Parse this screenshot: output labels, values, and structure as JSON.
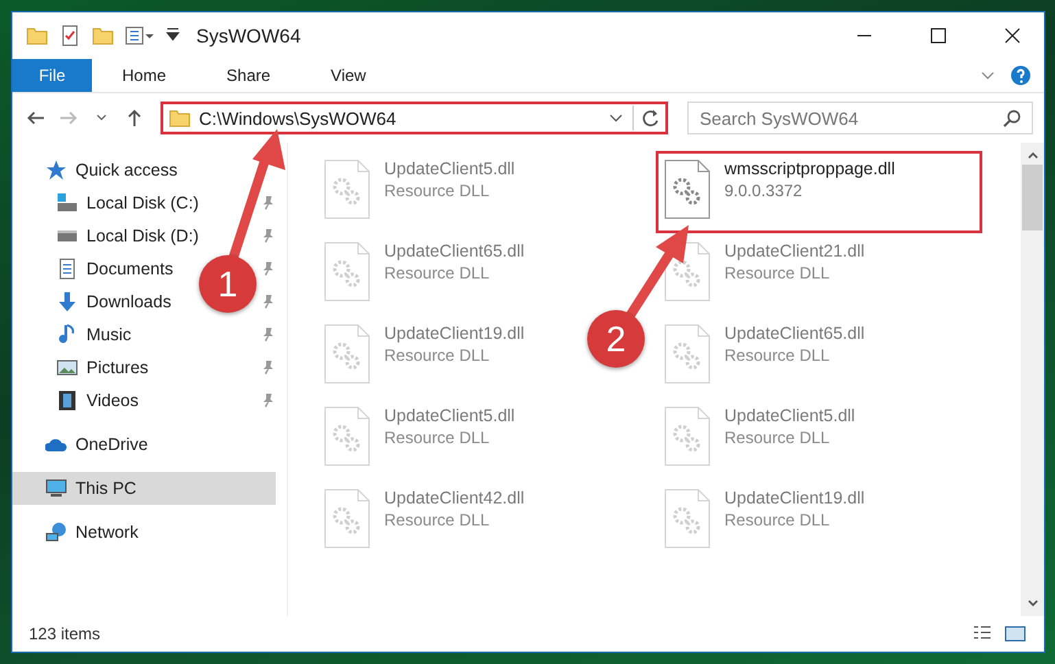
{
  "window": {
    "title": "SysWOW64"
  },
  "ribbon": {
    "file_button": "File",
    "tabs": [
      {
        "label": "Home"
      },
      {
        "label": "Share"
      },
      {
        "label": "View"
      }
    ]
  },
  "address_bar": {
    "path": "C:\\Windows\\SysWOW64",
    "highlighted": true
  },
  "search": {
    "placeholder": "Search SysWOW64"
  },
  "sidebar": {
    "items": [
      {
        "label": "Quick access",
        "kind": "star",
        "selected": false,
        "children": [
          {
            "label": "Local Disk (C:)",
            "kind": "drive-c",
            "pinned": true
          },
          {
            "label": "Local Disk (D:)",
            "kind": "drive",
            "pinned": true
          },
          {
            "label": "Documents",
            "kind": "documents",
            "pinned": true
          },
          {
            "label": "Downloads",
            "kind": "downloads",
            "pinned": true
          },
          {
            "label": "Music",
            "kind": "music",
            "pinned": true
          },
          {
            "label": "Pictures",
            "kind": "pictures",
            "pinned": true
          },
          {
            "label": "Videos",
            "kind": "videos",
            "pinned": true
          }
        ]
      },
      {
        "label": "OneDrive",
        "kind": "cloud",
        "selected": false
      },
      {
        "label": "This PC",
        "kind": "pc",
        "selected": true
      },
      {
        "label": "Network",
        "kind": "network",
        "selected": false
      }
    ]
  },
  "files": [
    {
      "name": "UpdateClient5.dll",
      "detail": "Resource DLL",
      "dimmed": true,
      "highlighted": false
    },
    {
      "name": "wmsscriptproppage.dll",
      "detail": "9.0.0.3372",
      "dimmed": false,
      "highlighted": true
    },
    {
      "name": "UpdateClient65.dll",
      "detail": "Resource DLL",
      "dimmed": true,
      "highlighted": false
    },
    {
      "name": "UpdateClient21.dll",
      "detail": "Resource DLL",
      "dimmed": true,
      "highlighted": false
    },
    {
      "name": "UpdateClient19.dll",
      "detail": "Resource DLL",
      "dimmed": true,
      "highlighted": false
    },
    {
      "name": "UpdateClient65.dll",
      "detail": "Resource DLL",
      "dimmed": true,
      "highlighted": false
    },
    {
      "name": "UpdateClient5.dll",
      "detail": "Resource DLL",
      "dimmed": true,
      "highlighted": false
    },
    {
      "name": "UpdateClient5.dll",
      "detail": "Resource DLL",
      "dimmed": true,
      "highlighted": false
    },
    {
      "name": "UpdateClient42.dll",
      "detail": "Resource DLL",
      "dimmed": true,
      "highlighted": false
    },
    {
      "name": "UpdateClient19.dll",
      "detail": "Resource DLL",
      "dimmed": true,
      "highlighted": false
    }
  ],
  "status_bar": {
    "item_count": "123 items"
  },
  "annotations": [
    {
      "label": "1"
    },
    {
      "label": "2"
    }
  ]
}
